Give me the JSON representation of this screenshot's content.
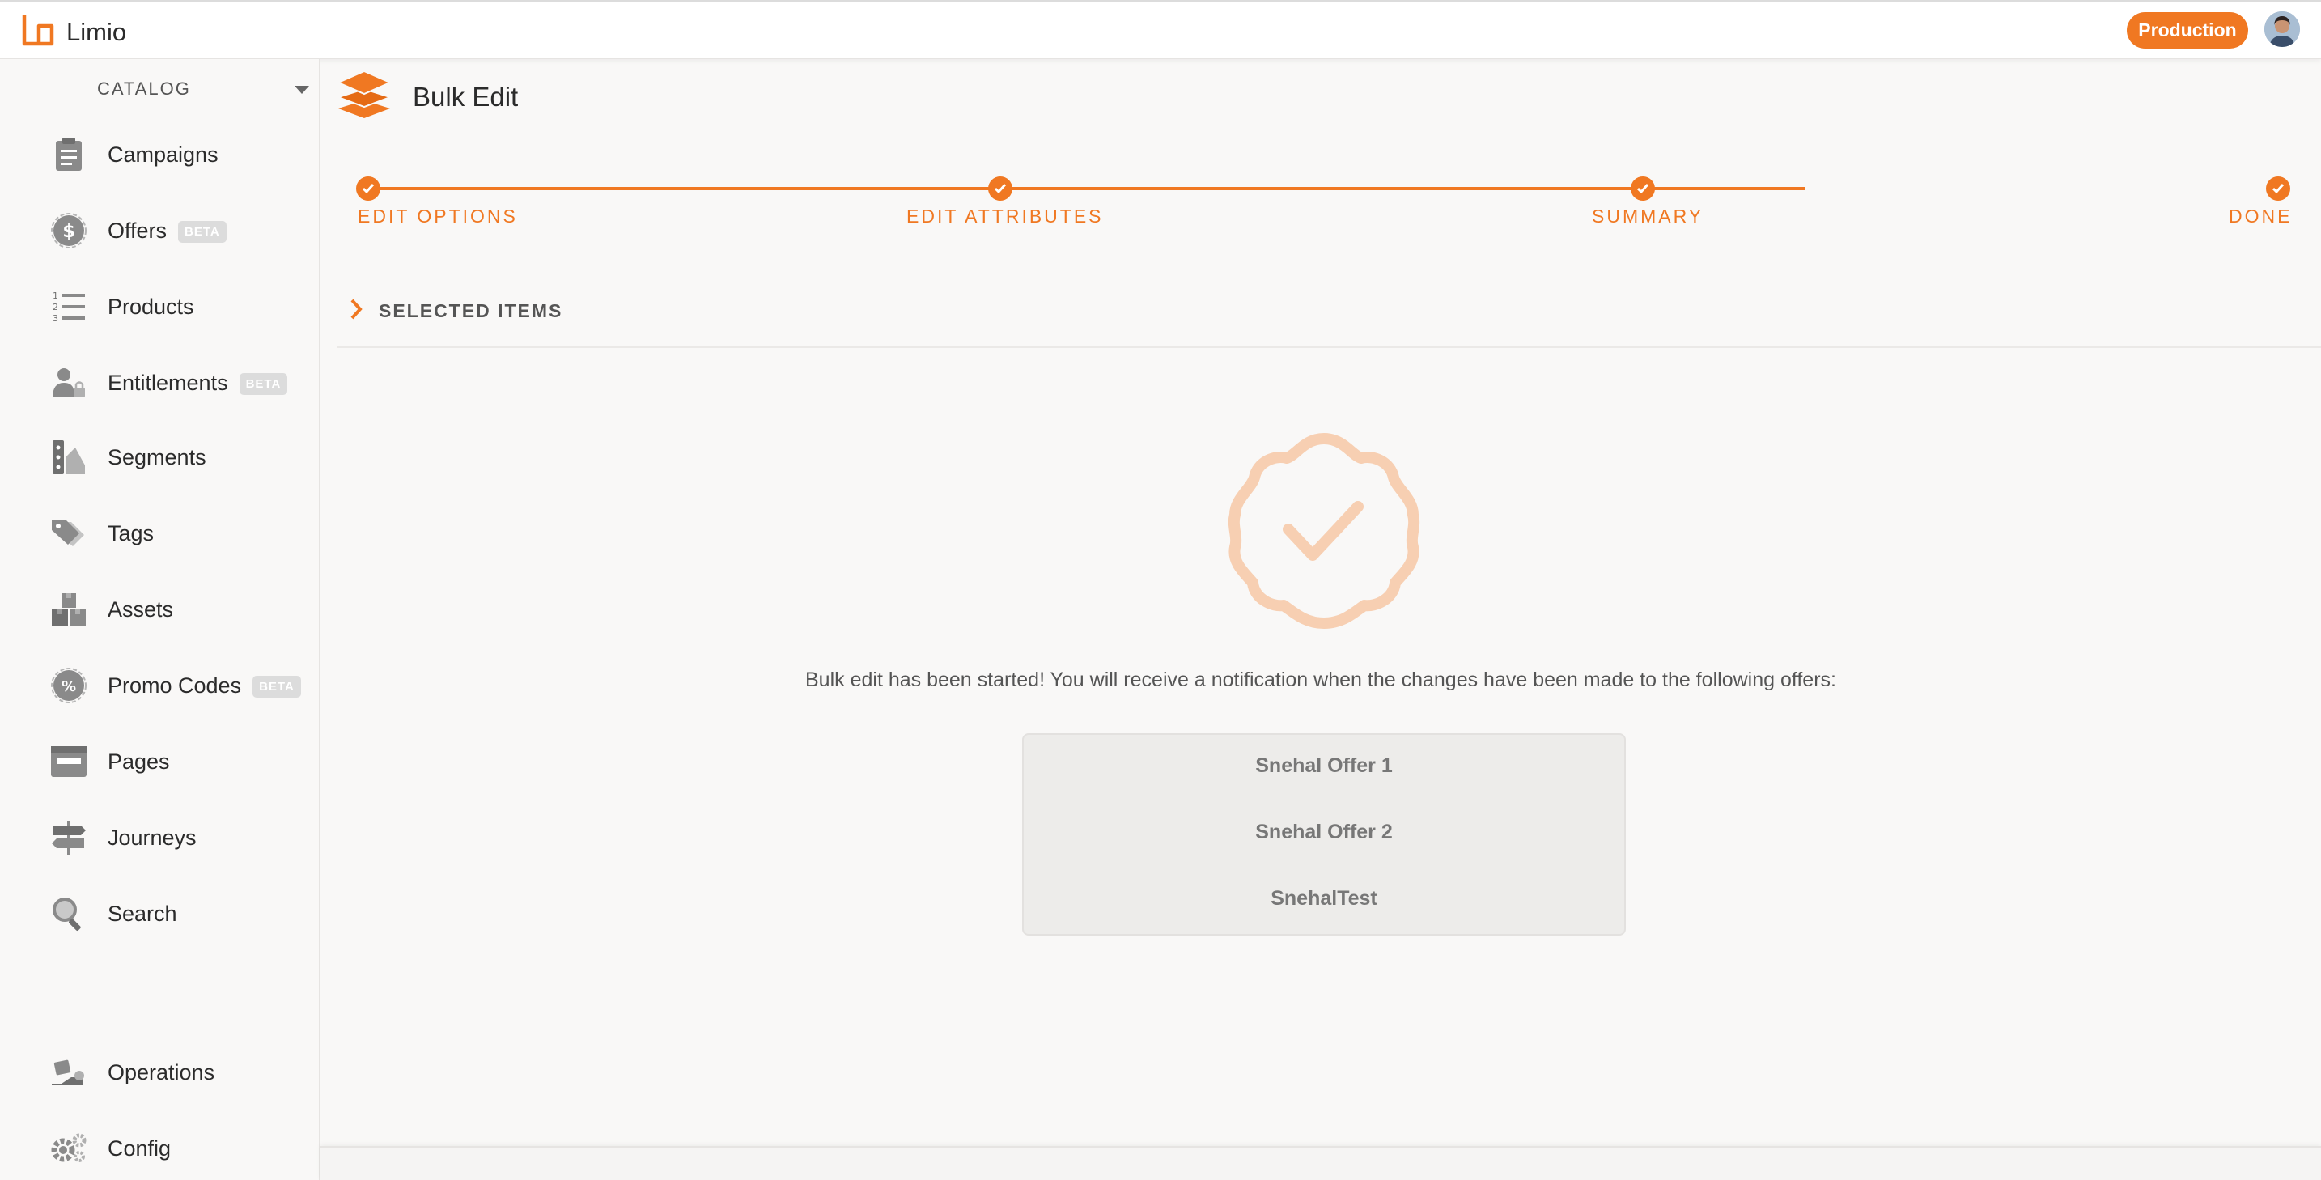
{
  "app": {
    "brand": "Limio",
    "environment": "Production"
  },
  "sidebar": {
    "section": "CATALOG",
    "items": [
      {
        "label": "Campaigns",
        "icon": "clipboard-icon",
        "beta": ""
      },
      {
        "label": "Offers",
        "icon": "dollar-badge-icon",
        "beta": "BETA"
      },
      {
        "label": "Products",
        "icon": "numbered-list-icon",
        "beta": ""
      },
      {
        "label": "Entitlements",
        "icon": "user-lock-icon",
        "beta": "BETA"
      },
      {
        "label": "Segments",
        "icon": "segments-icon",
        "beta": ""
      },
      {
        "label": "Tags",
        "icon": "tag-icon",
        "beta": ""
      },
      {
        "label": "Assets",
        "icon": "boxes-icon",
        "beta": ""
      },
      {
        "label": "Promo Codes",
        "icon": "percent-badge-icon",
        "beta": "BETA"
      },
      {
        "label": "Pages",
        "icon": "browser-page-icon",
        "beta": ""
      },
      {
        "label": "Journeys",
        "icon": "signpost-icon",
        "beta": ""
      },
      {
        "label": "Search",
        "icon": "search-icon",
        "beta": ""
      }
    ],
    "footer_items": [
      {
        "label": "Operations",
        "icon": "operations-icon"
      },
      {
        "label": "Config",
        "icon": "gears-icon"
      }
    ]
  },
  "page": {
    "title": "Bulk Edit",
    "steps": [
      "EDIT OPTIONS",
      "EDIT ATTRIBUTES",
      "SUMMARY",
      "DONE"
    ],
    "selected_items_label": "SELECTED ITEMS",
    "message": "Bulk edit has been started! You will receive a notification when the changes have been made to the following offers:",
    "offers": [
      "Snehal Offer 1",
      "Snehal Offer 2",
      "SnehalTest"
    ]
  },
  "colors": {
    "accent": "#f07822",
    "accent_light": "#f7cfb2",
    "icon_gray": "#8a8a8a"
  }
}
